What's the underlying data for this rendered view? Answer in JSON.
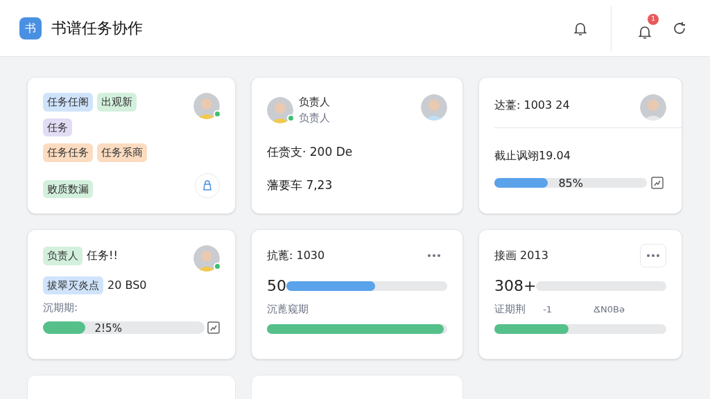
{
  "header": {
    "logo": "书",
    "title": "书谱任务协作",
    "notification_badge": "1"
  },
  "cards": [
    {
      "kind": "tags",
      "tag_rows": [
        [
          {
            "text": "任务任阁",
            "color": "#cfe3fb"
          },
          {
            "text": "出观新",
            "color": "#d3f0dd"
          }
        ],
        [
          {
            "text": "任务",
            "color": "#e3dcf5"
          }
        ],
        [
          {
            "text": "任务任务",
            "color": "#fbdcc0"
          },
          {
            "text": "任务系商",
            "color": "#fbdcc0"
          }
        ]
      ],
      "footer_tag": {
        "text": "败质数漏",
        "color": "#d3f0dd"
      },
      "avatar": {
        "online": true
      }
    },
    {
      "kind": "person",
      "name": "负责人",
      "role": "负责人",
      "avatar": {
        "online": true
      },
      "lines": [
        "任赍支· 200 De",
        "藩要车 7,23"
      ]
    },
    {
      "kind": "deadline",
      "title": "达薹: 1003 24",
      "date": "截止讽翊19.04",
      "progress": {
        "level": 0.35,
        "label": "85%",
        "color": "#5aa2ea"
      }
    },
    {
      "kind": "assignee",
      "rows": [
        {
          "tag": {
            "text": "负责人",
            "color": "#d3f0dd"
          },
          "text": "任务!!"
        },
        {
          "tag": {
            "text": "拔翠灭炎点",
            "color": "#cfe3fb"
          },
          "text": "20 BS0"
        }
      ],
      "label": "沉期期:",
      "progress": {
        "level": 0.26,
        "label": "2!5%",
        "color": "#55c08a"
      },
      "avatar": {
        "online": true
      }
    },
    {
      "kind": "stats",
      "title": "抗蓖: 1030",
      "value": "50",
      "bar": {
        "level": 0.55,
        "color": "#5aa2ea"
      },
      "label": "沉蓖窥期",
      "progress": {
        "level": 0.98,
        "color": "#55c08a"
      },
      "boxed_menu": false
    },
    {
      "kind": "stats",
      "title": "接画 2013",
      "value": "308+",
      "bar": {
        "color": "#e6e8ea"
      },
      "label": "证期荆",
      "extra": [
        "-1",
        "ՃN0Bə"
      ],
      "progress": {
        "level": 0.43,
        "color": "#55c08a"
      },
      "boxed_menu": true
    }
  ],
  "more_cards": [
    {
      "kind": "blank"
    },
    {
      "kind": "blank"
    }
  ]
}
